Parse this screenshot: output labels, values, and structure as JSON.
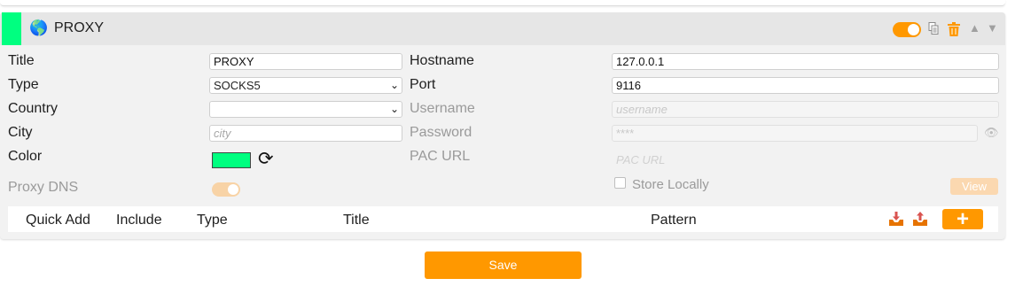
{
  "panel": {
    "title": "PROXY",
    "color": "#00ff80",
    "globe_icon": "🌎",
    "header_icons": [
      "toggle-on",
      "duplicate-icon",
      "trash-icon",
      "move-up-icon",
      "move-down-icon"
    ],
    "accent": "#ff9800"
  },
  "form": {
    "title_label": "Title",
    "title_value": "PROXY",
    "type_label": "Type",
    "type_value": "SOCKS5",
    "country_label": "Country",
    "country_value": "",
    "city_label": "City",
    "city_placeholder": "city",
    "color_label": "Color",
    "proxy_dns_label": "Proxy DNS",
    "hostname_label": "Hostname",
    "hostname_value": "127.0.0.1",
    "port_label": "Port",
    "port_value": "9116",
    "username_label": "Username",
    "username_placeholder": "username",
    "password_label": "Password",
    "password_placeholder": "****",
    "pac_label": "PAC URL",
    "pac_placeholder": "PAC URL",
    "store_locally_label": "Store Locally",
    "view_label": "View"
  },
  "rules": {
    "headers": {
      "quick_add": "Quick Add",
      "include": "Include",
      "type": "Type",
      "title": "Title",
      "pattern": "Pattern"
    },
    "add_label": "+"
  },
  "footer": {
    "save_label": "Save"
  }
}
